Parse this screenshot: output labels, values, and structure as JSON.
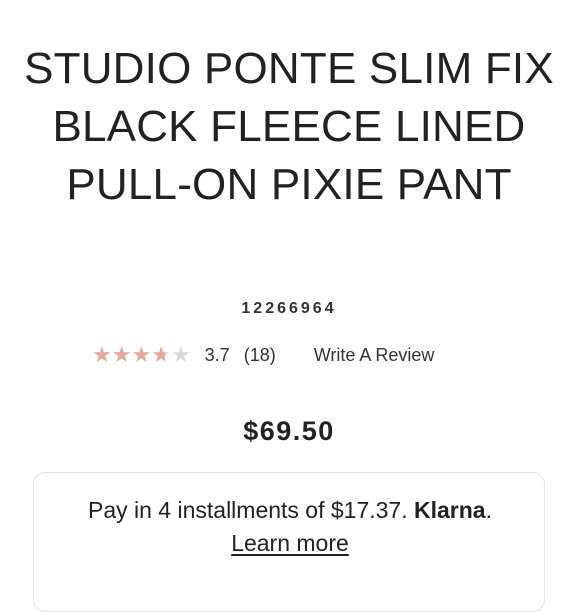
{
  "product": {
    "title": "STUDIO PONTE SLIM FIX BLACK FLEECE LINED PULL-ON PIXIE PANT",
    "sku": "12266964"
  },
  "rating": {
    "value": "3.7",
    "count_label": "(18)",
    "stars_out_of": 5,
    "write_review_label": "Write A Review",
    "colors": {
      "filled": "#e7a79b",
      "empty": "#d9d9d9"
    }
  },
  "price": {
    "amount": "$69.50"
  },
  "klarna": {
    "text": "Pay in 4 installments of $17.37.",
    "brand": "Klarna",
    "brand_suffix": ".",
    "learn_more_label": "Learn more"
  },
  "icons": {
    "star": "star-icon"
  }
}
